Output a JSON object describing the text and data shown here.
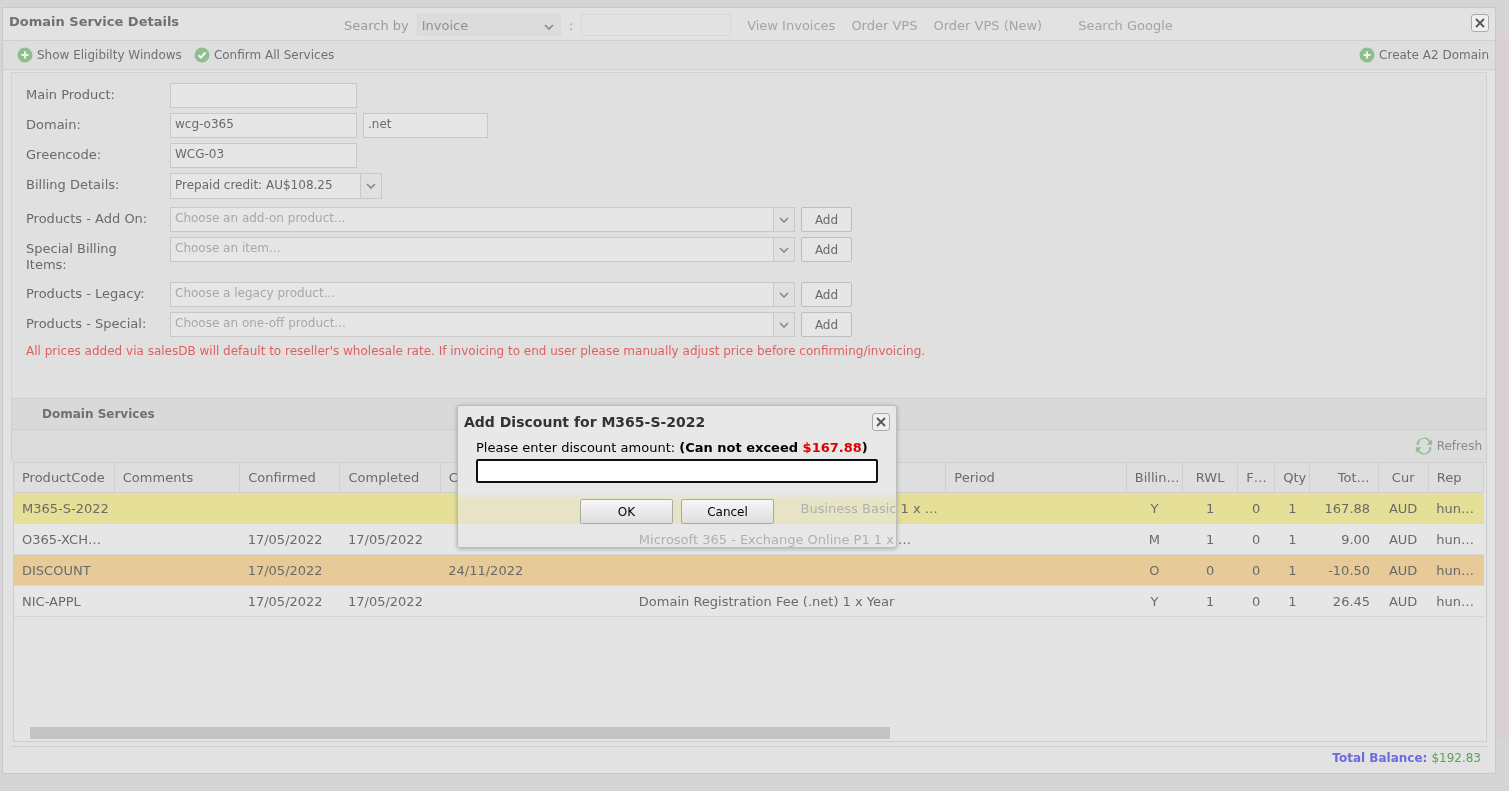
{
  "background_toolbar": {
    "items": [
      {
        "kind": "label",
        "text": "Search by"
      },
      {
        "kind": "select",
        "text": "Invoice"
      },
      {
        "kind": "label",
        "text": ":"
      },
      {
        "kind": "field"
      },
      {
        "kind": "link",
        "text": "View Invoices"
      },
      {
        "kind": "link",
        "text": "Order VPS"
      },
      {
        "kind": "link",
        "text": "Order VPS (New)"
      },
      {
        "kind": "link",
        "text": "Search Google"
      }
    ]
  },
  "window": {
    "title": "Domain Service Details"
  },
  "toolbar": {
    "left": [
      {
        "kind": "add",
        "label": "Show Eligibilty Windows"
      },
      {
        "kind": "check",
        "label": "Confirm All Services"
      }
    ],
    "right": [
      {
        "kind": "add",
        "label": "Create A2 Domain"
      }
    ]
  },
  "form": {
    "rows": [
      {
        "kind": "text",
        "label": "Main Product:",
        "blank": true
      },
      {
        "kind": "text",
        "label": "Domain:",
        "values": [
          {
            "value": "wcg-o365"
          },
          {
            "value": ".net"
          }
        ]
      },
      {
        "kind": "text",
        "label": "Greencode:",
        "values": [
          {
            "value": "WCG-03"
          }
        ]
      },
      {
        "kind": "select",
        "label": "Billing Details:",
        "value": "Prepaid credit: AU$108.25"
      },
      {
        "kind": "combo",
        "label": "Products - Add On:",
        "placeholder": "Choose an add-on product...",
        "button": "Add"
      },
      {
        "kind": "combo",
        "label": "Special Billing Items:",
        "placeholder": "Choose an item...",
        "button": "Add"
      },
      {
        "kind": "combo",
        "label": "Products - Legacy:",
        "placeholder": "Choose a legacy product...",
        "button": "Add"
      },
      {
        "kind": "combo",
        "label": "Products - Special:",
        "placeholder": "Choose an one-off product...",
        "button": "Add"
      }
    ],
    "notice": "All prices added via salesDB will default to reseller's wholesale rate. If invoicing to end user please manually adjust price before confirming/invoicing."
  },
  "services": {
    "title": "Domain Services",
    "refresh": "Refresh",
    "columns": [
      "ProductCode",
      "Comments",
      "Confirmed",
      "Completed",
      "C",
      "",
      "Period",
      "Billin…",
      "RWL",
      "F…",
      "Qty",
      "Tot…",
      "Cur",
      "Rep"
    ],
    "rows": [
      {
        "color": "#e5df98",
        "partly_covered": true,
        "cells": [
          "M365-S-2022",
          "",
          "",
          "",
          "",
          "Business Basic 1 x …",
          "",
          "Y",
          "1",
          "0",
          "1",
          "167.88",
          "AUD",
          "hun…"
        ]
      },
      {
        "color": "#e6e6e6",
        "cells": [
          "O365-XCH…",
          "",
          "17/05/2022",
          "17/05/2022",
          "",
          "Microsoft 365 - Exchange Online P1 1 x …",
          "",
          "M",
          "1",
          "0",
          "1",
          "9.00",
          "AUD",
          "hun…"
        ]
      },
      {
        "color": "#e6cb98",
        "cells": [
          "DISCOUNT",
          "",
          "17/05/2022",
          "",
          "24/11/2022",
          "",
          "",
          "O",
          "0",
          "0",
          "1",
          "-10.50",
          "AUD",
          "hun…"
        ]
      },
      {
        "color": "#e6e6e6",
        "cells": [
          "NIC-APPL",
          "",
          "17/05/2022",
          "17/05/2022",
          "",
          "Domain Registration Fee (.net) 1 x Year",
          "",
          "Y",
          "1",
          "0",
          "1",
          "26.45",
          "AUD",
          "hun…"
        ]
      }
    ],
    "total_label": "Total Balance:",
    "total_value": "$192.83"
  },
  "dialog": {
    "title": "Add Discount for M365-S-2022",
    "prompt": "Please enter discount amount:",
    "limit": "(Can not exceed",
    "amount": "$167.88",
    "limit_end": ")",
    "buttons": [
      "OK",
      "Cancel"
    ]
  }
}
